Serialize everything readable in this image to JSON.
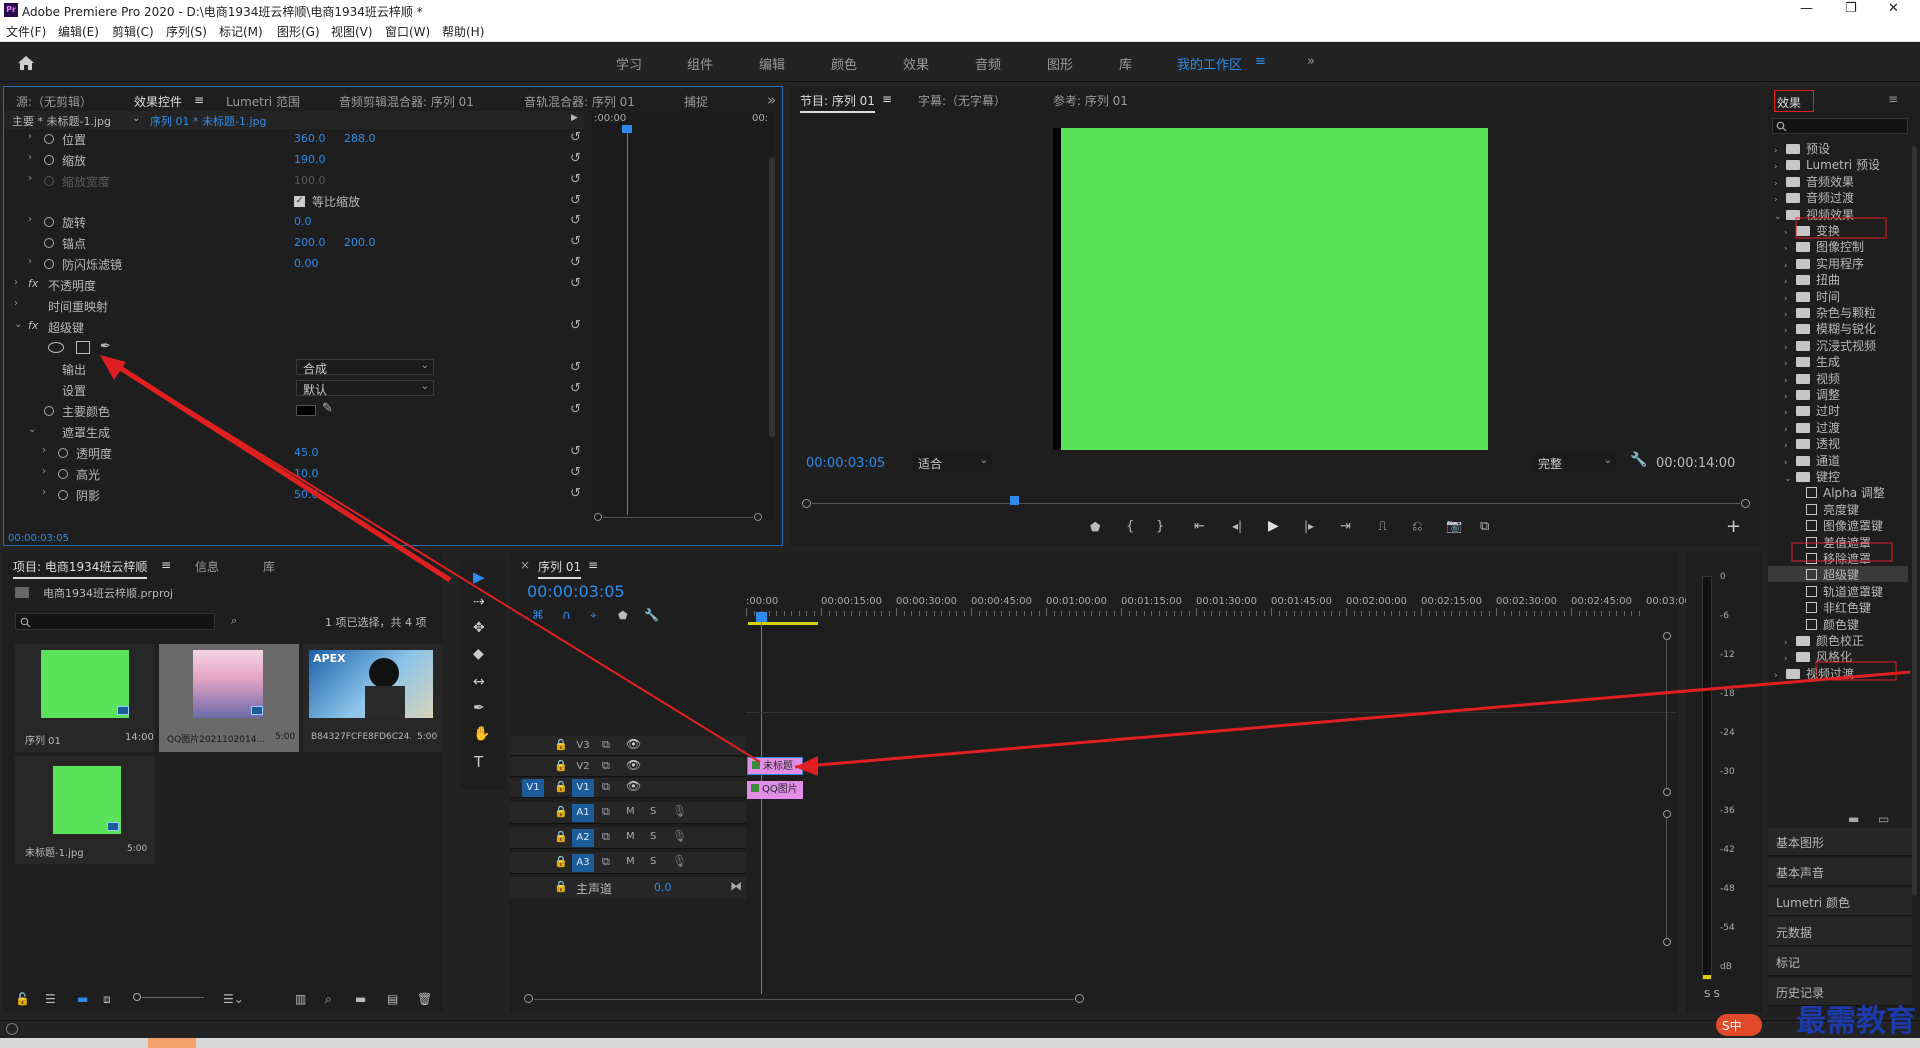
{
  "window": {
    "title": "Adobe Premiere Pro 2020 - D:\\电商1934班云梓顺\\电商1934班云梓顺 *",
    "app_logo": "Pr",
    "controls": [
      "—",
      "❐",
      "✕"
    ]
  },
  "menu": [
    "文件(F)",
    "编辑(E)",
    "剪辑(C)",
    "序列(S)",
    "标记(M)",
    "图形(G)",
    "视图(V)",
    "窗口(W)",
    "帮助(H)"
  ],
  "workspaces": [
    "学习",
    "组件",
    "编辑",
    "颜色",
    "效果",
    "音频",
    "图形",
    "库",
    "我的工作区"
  ],
  "workspace_menu": "≡",
  "workspace_more": "»",
  "effect_controls": {
    "tabs": [
      "源:（无剪辑）",
      "效果控件",
      "Lumetri 范围",
      "音频剪辑混合器: 序列 01",
      "音轨混合器: 序列 01",
      "捕捉"
    ],
    "tab_menu": "≡",
    "more": "»",
    "master": "主要 * 未标题-1.jpg",
    "sequence": "序列 01 * 未标题-1.jpg",
    "ruler_start": ":00:00",
    "ruler_end": "00:",
    "rows": [
      {
        "label": "位置",
        "v1": "360.0",
        "v2": "288.0"
      },
      {
        "label": "缩放",
        "v1": "190.0",
        "v2": ""
      },
      {
        "label": "缩放宽度",
        "v1": "100.0",
        "v2": ""
      },
      {
        "label": "等比缩放",
        "v1": "",
        "v2": ""
      },
      {
        "label": "旋转",
        "v1": "0.0",
        "v2": ""
      },
      {
        "label": "锚点",
        "v1": "200.0",
        "v2": "200.0"
      },
      {
        "label": "防闪烁滤镜",
        "v1": "0.00",
        "v2": ""
      },
      {
        "label": "不透明度",
        "v1": "",
        "v2": ""
      },
      {
        "label": "时间重映射",
        "v1": "",
        "v2": ""
      },
      {
        "label": "超级键",
        "v1": "",
        "v2": ""
      },
      {
        "label": "输出",
        "v1": "合成",
        "v2": ""
      },
      {
        "label": "设置",
        "v1": "默认",
        "v2": ""
      },
      {
        "label": "主要颜色",
        "v1": "",
        "v2": ""
      },
      {
        "label": "遮罩生成",
        "v1": "",
        "v2": ""
      },
      {
        "label": "透明度",
        "v1": "45.0",
        "v2": ""
      },
      {
        "label": "高光",
        "v1": "10.0",
        "v2": ""
      },
      {
        "label": "阴影",
        "v1": "50.0",
        "v2": ""
      }
    ],
    "timecode": "00:00:03:05"
  },
  "program": {
    "tabs": [
      "节目: 序列 01",
      "字幕:（无字幕）",
      "参考: 序列 01"
    ],
    "tab_menu": "≡",
    "timecode": "00:00:03:05",
    "fit": "适合",
    "quality": "完整",
    "duration": "00:00:14:00",
    "frame_color": "#5ae35a",
    "add": "+"
  },
  "effects": {
    "title": "效果",
    "menu": "≡",
    "items": [
      {
        "label": "预设",
        "indent": 0,
        "kind": "folder"
      },
      {
        "label": "Lumetri 预设",
        "indent": 0,
        "kind": "folder"
      },
      {
        "label": "音频效果",
        "indent": 0,
        "kind": "folder"
      },
      {
        "label": "音频过渡",
        "indent": 0,
        "kind": "folder"
      },
      {
        "label": "视频效果",
        "indent": 0,
        "kind": "folder",
        "open": true
      },
      {
        "label": "变换",
        "indent": 1,
        "kind": "folder"
      },
      {
        "label": "图像控制",
        "indent": 1,
        "kind": "folder"
      },
      {
        "label": "实用程序",
        "indent": 1,
        "kind": "folder"
      },
      {
        "label": "扭曲",
        "indent": 1,
        "kind": "folder"
      },
      {
        "label": "时间",
        "indent": 1,
        "kind": "folder"
      },
      {
        "label": "杂色与颗粒",
        "indent": 1,
        "kind": "folder"
      },
      {
        "label": "模糊与锐化",
        "indent": 1,
        "kind": "folder"
      },
      {
        "label": "沉浸式视频",
        "indent": 1,
        "kind": "folder"
      },
      {
        "label": "生成",
        "indent": 1,
        "kind": "folder"
      },
      {
        "label": "视频",
        "indent": 1,
        "kind": "folder"
      },
      {
        "label": "调整",
        "indent": 1,
        "kind": "folder"
      },
      {
        "label": "过时",
        "indent": 1,
        "kind": "folder"
      },
      {
        "label": "过渡",
        "indent": 1,
        "kind": "folder"
      },
      {
        "label": "透视",
        "indent": 1,
        "kind": "folder"
      },
      {
        "label": "通道",
        "indent": 1,
        "kind": "folder"
      },
      {
        "label": "键控",
        "indent": 1,
        "kind": "folder",
        "open": true
      },
      {
        "label": "Alpha 调整",
        "indent": 2,
        "kind": "fx"
      },
      {
        "label": "亮度键",
        "indent": 2,
        "kind": "fx"
      },
      {
        "label": "图像遮罩键",
        "indent": 2,
        "kind": "fx"
      },
      {
        "label": "差值遮罩",
        "indent": 2,
        "kind": "fx"
      },
      {
        "label": "移除遮罩",
        "indent": 2,
        "kind": "fx"
      },
      {
        "label": "超级键",
        "indent": 2,
        "kind": "fx",
        "selected": true
      },
      {
        "label": "轨道遮罩键",
        "indent": 2,
        "kind": "fx"
      },
      {
        "label": "非红色键",
        "indent": 2,
        "kind": "fx"
      },
      {
        "label": "颜色键",
        "indent": 2,
        "kind": "fx"
      },
      {
        "label": "颜色校正",
        "indent": 1,
        "kind": "folder"
      },
      {
        "label": "风格化",
        "indent": 1,
        "kind": "folder"
      },
      {
        "label": "视频过渡",
        "indent": 0,
        "kind": "folder"
      }
    ],
    "panels": [
      "基本图形",
      "基本声音",
      "Lumetri 颜色",
      "元数据",
      "标记",
      "历史记录"
    ]
  },
  "project": {
    "tabs": [
      "项目: 电商1934班云梓顺",
      "信息",
      "库"
    ],
    "tab_menu": "≡",
    "file": "电商1934班云梓顺.prproj",
    "status": "1 项已选择，共 4 项",
    "items": [
      {
        "name": "序列 01",
        "dur": "14:00",
        "thumb": "green"
      },
      {
        "name": "QQ图片2021102014...",
        "dur": "5:00",
        "thumb": "anime"
      },
      {
        "name": "B84327FCFE8FD6C24...",
        "dur": "5:00",
        "thumb": "apex"
      },
      {
        "name": "未标题-1.jpg",
        "dur": "5:00",
        "thumb": "green"
      }
    ],
    "apex_label": "APEX"
  },
  "tools": [
    "▶",
    "⇢",
    "✥",
    "◆",
    "↔",
    "✒",
    "✋",
    "T"
  ],
  "timeline": {
    "close": "×",
    "tab": "序列 01",
    "tab_menu": "≡",
    "timecode": "00:00:03:05",
    "ruler": [
      ":00:00",
      "00:00:15:00",
      "00:00:30:00",
      "00:00:45:00",
      "00:01:00:00",
      "00:01:15:00",
      "00:01:30:00",
      "00:01:45:00",
      "00:02:00:00",
      "00:02:15:00",
      "00:02:30:00",
      "00:02:45:00",
      "00:03:00"
    ],
    "video_tracks": [
      "V3",
      "V2",
      "V1"
    ],
    "audio_tracks": [
      "A1",
      "A2",
      "A3"
    ],
    "source_patch": "V1",
    "mute": "M",
    "solo": "S",
    "master_label": "主声道",
    "master_value": "0.0",
    "clip_v2": "未标题",
    "clip_v1": "QQ图片"
  },
  "meter": {
    "ticks": [
      "0",
      "-6",
      "-12",
      "-18",
      "-24",
      "-30",
      "-36",
      "-42",
      "-48",
      "-54",
      "dB"
    ],
    "solo": "S S"
  },
  "watermark": "最需教育",
  "ime": "S中"
}
